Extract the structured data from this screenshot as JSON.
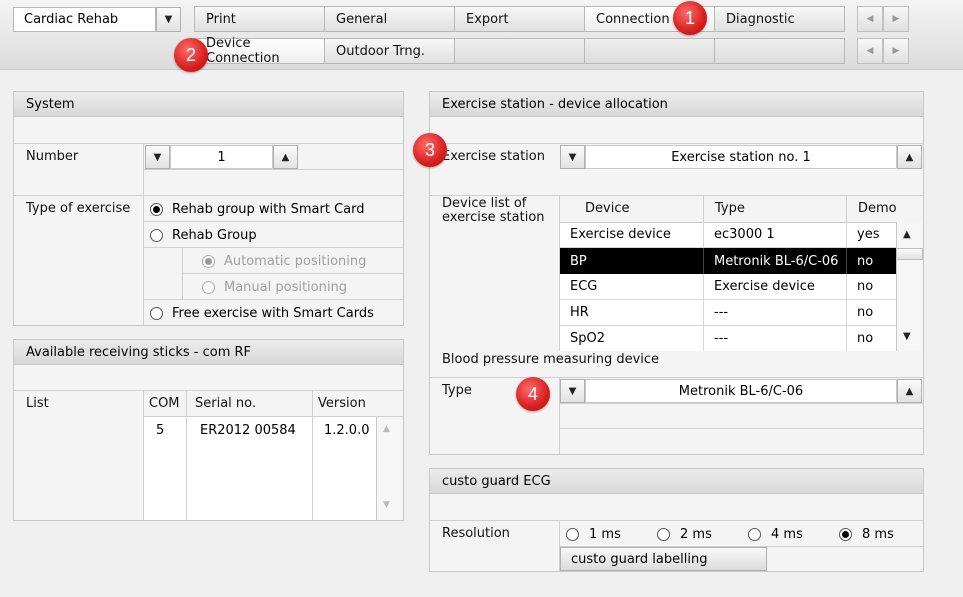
{
  "top": {
    "module_select": "Cardiac Rehab",
    "tabs_row1": [
      "Print",
      "General",
      "Export",
      "Connection",
      "Diagnostic"
    ],
    "tabs_row2": [
      "Device Connection",
      "Outdoor Trng.",
      "",
      "",
      ""
    ]
  },
  "badges": [
    "1",
    "2",
    "3",
    "4"
  ],
  "system": {
    "title": "System",
    "number_label": "Number",
    "number_value": "1",
    "type_label": "Type of exercise",
    "options": {
      "rehab_smart": "Rehab group with Smart Card",
      "rehab_group": "Rehab Group",
      "auto_pos": "Automatic positioning",
      "manual_pos": "Manual positioning",
      "free": "Free exercise with Smart Cards"
    }
  },
  "sticks": {
    "title": "Available receiving sticks - com RF",
    "list_label": "List",
    "columns": [
      "COM",
      "Serial no.",
      "Version"
    ],
    "rows": [
      [
        "5",
        "ER2012 00584",
        "1.2.0.0"
      ]
    ]
  },
  "station": {
    "title": "Exercise station - device allocation",
    "station_label": "Exercise station",
    "station_value": "Exercise station no. 1",
    "device_list_label": "Device list of exercise station",
    "columns": [
      "Device",
      "Type",
      "Demo"
    ],
    "rows": [
      [
        "Exercise device",
        "ec3000 1",
        "yes"
      ],
      [
        "BP",
        "Metronik BL-6/C-06",
        "no"
      ],
      [
        "ECG",
        "Exercise device",
        "no"
      ],
      [
        "HR",
        "---",
        "no"
      ],
      [
        "SpO2",
        "---",
        "no"
      ]
    ],
    "bp_label": "Blood pressure measuring device",
    "bp_type_label": "Type",
    "bp_type_value": "Metronik BL-6/C-06"
  },
  "ecg": {
    "title": "custo guard ECG",
    "resolution_label": "Resolution",
    "options": [
      "1 ms",
      "2 ms",
      "4 ms",
      "8 ms"
    ],
    "selected": "8 ms",
    "labelling_button": "custo guard labelling"
  }
}
